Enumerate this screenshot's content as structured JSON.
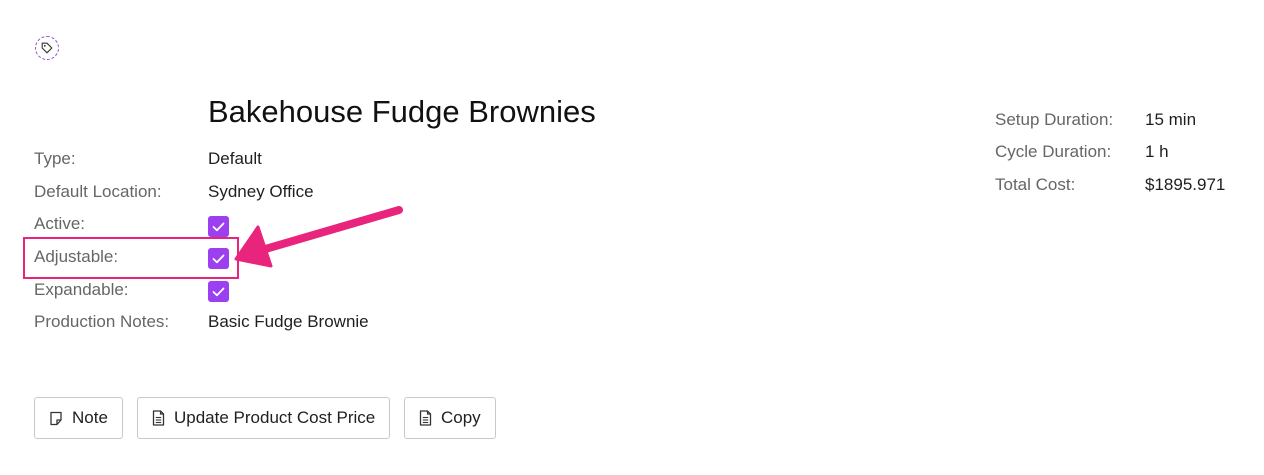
{
  "product": {
    "title": "Bakehouse Fudge Brownies",
    "tag_icon": "tag-icon"
  },
  "details": {
    "type_label": "Type:",
    "type_value": "Default",
    "location_label": "Default Location:",
    "location_value": "Sydney Office",
    "active_label": "Active:",
    "active_checked": true,
    "adjustable_label": "Adjustable:",
    "adjustable_checked": true,
    "expandable_label": "Expandable:",
    "expandable_checked": true,
    "notes_label": "Production Notes:",
    "notes_value": "Basic Fudge Brownie"
  },
  "summary": {
    "setup_label": "Setup Duration:",
    "setup_value": "15 min",
    "cycle_label": "Cycle Duration:",
    "cycle_value": "1 h",
    "cost_label": "Total Cost:",
    "cost_value": "$1895.971"
  },
  "actions": {
    "note_label": "Note",
    "note_icon": "note-icon",
    "update_cost_label": "Update Product Cost Price",
    "update_cost_icon": "document-icon",
    "copy_label": "Copy",
    "copy_icon": "document-icon"
  },
  "colors": {
    "accent": "#9b3ff0",
    "annotation": "#e8247c"
  }
}
